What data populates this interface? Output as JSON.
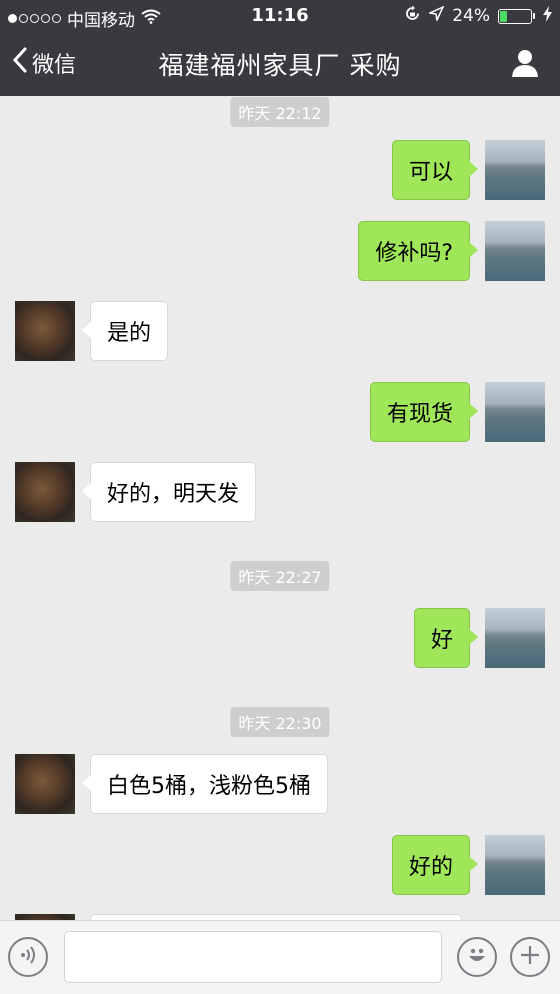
{
  "status_bar": {
    "carrier": "中国移动",
    "time": "11:16",
    "battery": "24%",
    "battery_level": 0.24,
    "signal_bars_filled": 1,
    "icons": [
      "wifi-icon",
      "rotation-lock-icon",
      "location-icon",
      "battery-icon",
      "charging-icon"
    ]
  },
  "nav": {
    "back_label": "微信",
    "title": "福建福州家具厂 采购",
    "right_icon": "profile-icon"
  },
  "messages": [
    {
      "type": "timestamp",
      "text": "昨天 22:12"
    },
    {
      "type": "message",
      "from": "me",
      "text": "可以"
    },
    {
      "type": "message",
      "from": "me",
      "text": "修补吗?"
    },
    {
      "type": "message",
      "from": "other",
      "text": "是的"
    },
    {
      "type": "message",
      "from": "me",
      "text": "有现货"
    },
    {
      "type": "message",
      "from": "other",
      "text": "好的，明天发"
    },
    {
      "type": "timestamp",
      "text": "昨天 22:27"
    },
    {
      "type": "message",
      "from": "me",
      "text": "好"
    },
    {
      "type": "timestamp",
      "text": "昨天 22:30"
    },
    {
      "type": "message",
      "from": "other",
      "text": "白色5桶，浅粉色5桶"
    },
    {
      "type": "message",
      "from": "me",
      "text": "好的"
    }
  ],
  "input_bar": {
    "value": "",
    "left_icon": "voice-icon",
    "emoji_icon": "emoji-icon",
    "plus_icon": "plus-icon"
  },
  "colors": {
    "nav_bg": "#393a3f",
    "chat_bg": "#ebebeb",
    "my_bubble": "#9fe658",
    "their_bubble": "#ffffff",
    "timestamp_bg": "#cecece"
  }
}
